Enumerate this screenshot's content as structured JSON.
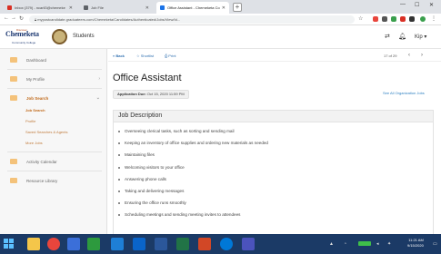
{
  "browser": {
    "tabs": [
      {
        "label": "Inbox (379) - ncarli3@chemeke",
        "favicon_color": "#d93025",
        "active": false
      },
      {
        "label": "Job File",
        "favicon_color": "#5f6368",
        "active": false
      },
      {
        "label": "Office Assistant - Chemeketa Co",
        "favicon_color": "#1a73e8",
        "active": true
      }
    ],
    "newtab_label": "+",
    "address": "mypostcandidate.graduateers.com/Chemeketa/Candidates/Authenticated/Jobs/View/Id...",
    "window_controls": [
      "—",
      "☐",
      "✕"
    ]
  },
  "site": {
    "logo_top": "Discover",
    "logo_text": "Chemeketa",
    "logo_bottom": "Community College",
    "section": "Students",
    "user_name": "Kip",
    "user_chevron": "▾"
  },
  "sidebar": {
    "items": [
      {
        "label": "Dashboard",
        "icon": "dashboard-icon"
      },
      {
        "label": "My Profile",
        "icon": "profile-icon"
      },
      {
        "label": "Job Search",
        "icon": "briefcase-icon",
        "current": true
      },
      {
        "label": "Activity Calendar",
        "icon": "calendar-icon"
      },
      {
        "label": "Resource Library",
        "icon": "library-icon"
      }
    ],
    "subitems": [
      {
        "label": "Job Search",
        "current": true
      },
      {
        "label": "Profile"
      },
      {
        "label": "Saved Searches & Agents"
      },
      {
        "label": "More Jobs"
      }
    ]
  },
  "toolbar": {
    "back_label": "« Back",
    "shortlist_label": "☆ Shortlist",
    "print_label": "⎙ Print",
    "pager_text": "17 of 29",
    "prev": "‹",
    "next": "›"
  },
  "job": {
    "title": "Office Assistant",
    "app_date_label": "Application Due:",
    "app_date_value": "Oct 15, 2020   11:59 PM",
    "see_all_label": "See All Organization Jobs",
    "description_header": "Job Description",
    "duties": [
      "Overseeing clerical tasks, such as sorting and sending mail",
      "Keeping an inventory of office supplies and ordering new materials as needed",
      "Maintaining files",
      "Welcoming visitors to your office",
      "Answering phone calls",
      "Taking and delivering messages",
      "Ensuring the office runs smoothly",
      "Scheduling meetings and sending meeting invites to attendees"
    ]
  },
  "taskbar": {
    "apps": [
      {
        "name": "explorer-app",
        "color": "#f4c64a"
      },
      {
        "name": "chrome-app",
        "color": "#e8453c"
      },
      {
        "name": "files-app",
        "color": "#3b6fd9"
      },
      {
        "name": "media-app",
        "color": "#2d9a3e"
      },
      {
        "name": "store-app",
        "color": "#1e7fd6"
      },
      {
        "name": "outlook-app",
        "color": "#0a64c9"
      },
      {
        "name": "word-app",
        "color": "#2b579a"
      },
      {
        "name": "excel-app",
        "color": "#217346"
      },
      {
        "name": "powerpoint-app",
        "color": "#d24726"
      },
      {
        "name": "edge-app",
        "color": "#0078d7"
      },
      {
        "name": "teams-app",
        "color": "#4b53bc"
      }
    ],
    "time": "11:21 AM",
    "date": "9/15/2020"
  }
}
